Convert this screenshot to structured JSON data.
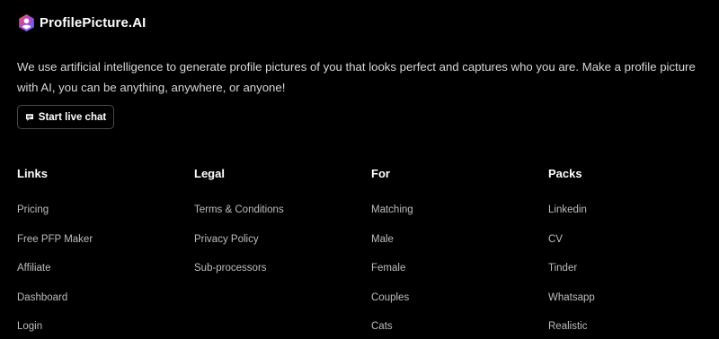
{
  "brand": {
    "name": "ProfilePicture.AI"
  },
  "description": "We use artificial intelligence to generate profile pictures of you that looks perfect and captures who you are. Make a profile picture with AI, you can be anything, anywhere, or anyone!",
  "chat_button": {
    "label": "Start live chat",
    "icon": "chat-bubble-icon"
  },
  "columns": [
    {
      "title": "Links",
      "items": [
        "Pricing",
        "Free PFP Maker",
        "Affiliate",
        "Dashboard",
        "Login"
      ]
    },
    {
      "title": "Legal",
      "items": [
        "Terms & Conditions",
        "Privacy Policy",
        "Sub-processors"
      ]
    },
    {
      "title": "For",
      "items": [
        "Matching",
        "Male",
        "Female",
        "Couples",
        "Cats"
      ]
    },
    {
      "title": "Packs",
      "items": [
        "Linkedin",
        "CV",
        "Tinder",
        "Whatsapp",
        "Realistic"
      ]
    }
  ],
  "colors": {
    "background": "#000000",
    "text": "#ffffff",
    "muted_text": "#bdbdbd",
    "logo_gradient": [
      "#f2545b",
      "#a34ad9",
      "#3d7bf2"
    ]
  }
}
